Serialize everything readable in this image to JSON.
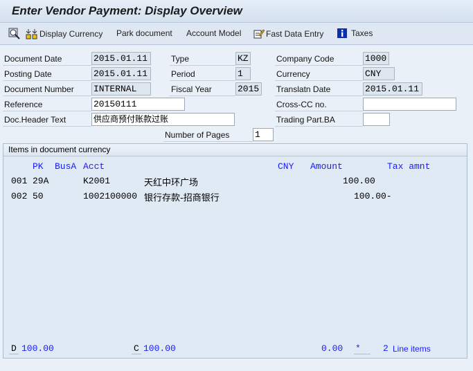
{
  "title": "Enter Vendor Payment: Display Overview",
  "toolbar": {
    "display_currency": "Display Currency",
    "park_document": "Park document",
    "account_model": "Account Model",
    "fast_data_entry": "Fast Data Entry",
    "taxes": "Taxes"
  },
  "header": {
    "document_date": {
      "label": "Document Date",
      "value": "2015.01.11"
    },
    "posting_date": {
      "label": "Posting Date",
      "value": "2015.01.11"
    },
    "document_number": {
      "label": "Document Number",
      "value": "INTERNAL"
    },
    "reference": {
      "label": "Reference",
      "value": "20150111"
    },
    "doc_header_text": {
      "label": "Doc.Header Text",
      "value": "供应商预付账款过账"
    },
    "type": {
      "label": "Type",
      "value": "KZ"
    },
    "period": {
      "label": "Period",
      "value": "1"
    },
    "fiscal_year": {
      "label": "Fiscal Year",
      "value": "2015"
    },
    "company_code": {
      "label": "Company Code",
      "value": "1000"
    },
    "currency": {
      "label": "Currency",
      "value": "CNY"
    },
    "translatn_date": {
      "label": "Translatn Date",
      "value": "2015.01.11"
    },
    "cross_cc": {
      "label": "Cross-CC no.",
      "value": ""
    },
    "trading_part": {
      "label": "Trading Part.BA",
      "value": ""
    },
    "pages": {
      "label": "Number of Pages",
      "value": "1"
    }
  },
  "items": {
    "title": "Items in document currency",
    "columns": {
      "pk": "PK",
      "busa": "BusA",
      "acct": "Acct",
      "cny": "CNY",
      "amount": "Amount",
      "tax": "Tax amnt"
    },
    "rows": [
      {
        "no": "001",
        "pk": "29A",
        "acct": "K2001",
        "name": "天红中环广场",
        "amount": "100.00"
      },
      {
        "no": "002",
        "pk": "50",
        "acct": "1002100000",
        "name": "银行存款-招商银行",
        "amount": "100.00-"
      }
    ],
    "footer": {
      "d": "D",
      "d_val": "100.00",
      "c": "C",
      "c_val": "100.00",
      "balance": "0.00",
      "star": "*",
      "count": "2",
      "line_items": "Line items"
    }
  }
}
